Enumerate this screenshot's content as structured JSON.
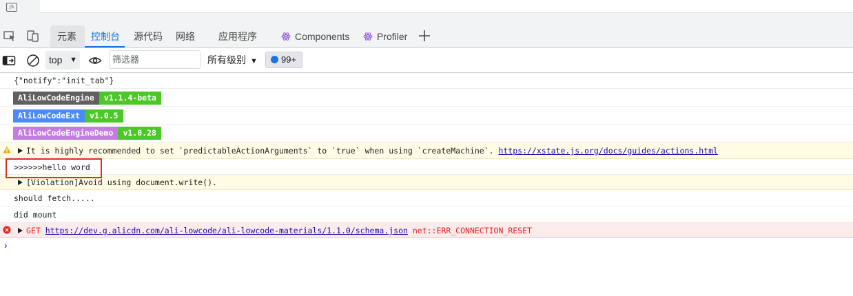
{
  "top_strip": {
    "file_badge": "JS"
  },
  "tabs": [
    {
      "label": "元素",
      "selected": true
    },
    {
      "label": "控制台",
      "active": true
    },
    {
      "label": "源代码"
    },
    {
      "label": "网络"
    },
    {
      "label": "应用程序"
    },
    {
      "label": "Components"
    },
    {
      "label": "Profiler"
    }
  ],
  "toolbar": {
    "context": "top",
    "filter_placeholder": "筛选器",
    "levels": "所有级别",
    "issues_count": "99+"
  },
  "console": {
    "messages": [
      {
        "type": "log",
        "text": "{\"notify\":\"init_tab\"}"
      },
      {
        "type": "badge",
        "name": "AliLowCodeEngine",
        "version": "v1.1.4-beta",
        "name_color": "#606060",
        "version_color": "#4cc728"
      },
      {
        "type": "badge",
        "name": "AliLowCodeExt",
        "version": "v1.0.5",
        "name_color": "#4a8bf5",
        "version_color": "#4cc728"
      },
      {
        "type": "badge",
        "name": "AliLowCodeEngineDemo",
        "version": "v1.0.28",
        "name_color": "#c47ce0",
        "version_color": "#4cc728"
      },
      {
        "type": "warn",
        "text": "It is highly recommended to set `predictableActionArguments` to `true` when using `createMachine`.",
        "link": "https://xstate.js.org/docs/guides/actions.html"
      },
      {
        "type": "log",
        "text": ">>>>>>hello word",
        "highlighted": true
      },
      {
        "type": "warn",
        "text": "[Violation]Avoid using document.write()."
      },
      {
        "type": "log",
        "text": "should fetch....."
      },
      {
        "type": "log",
        "text": "did mount"
      },
      {
        "type": "error",
        "method": "GET",
        "link": "https://dev.g.alicdn.com/ali-lowcode/ali-lowcode-materials/1.1.0/schema.json",
        "suffix": "net::ERR_CONNECTION_RESET"
      }
    ],
    "prompt_symbol": "›"
  },
  "colors": {
    "accent": "#1a73e8",
    "highlight_border": "#d93025",
    "warn_bg": "#fffbe5",
    "error_bg": "#fcebeb"
  }
}
